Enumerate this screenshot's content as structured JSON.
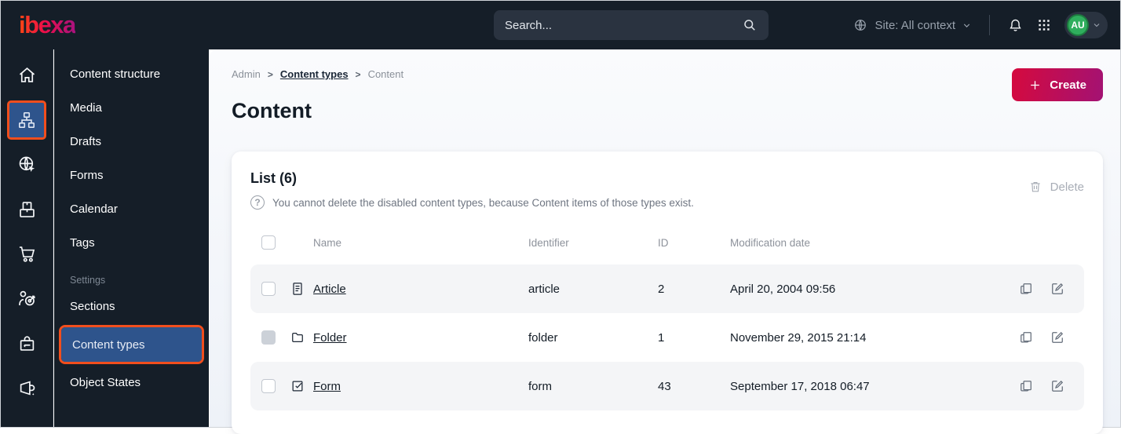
{
  "topbar": {
    "logo": "ibexa",
    "search_placeholder": "Search...",
    "site_context": "Site: All context",
    "avatar_initials": "AU"
  },
  "icon_rail": {
    "icons": [
      "home",
      "content-structure",
      "site",
      "product-catalog",
      "commerce",
      "personalization",
      "admin",
      "marketing"
    ],
    "selected": "content-structure"
  },
  "sidebar": {
    "items": [
      {
        "label": "Content structure"
      },
      {
        "label": "Media"
      },
      {
        "label": "Drafts"
      },
      {
        "label": "Forms"
      },
      {
        "label": "Calendar"
      },
      {
        "label": "Tags"
      }
    ],
    "settings_label": "Settings",
    "settings_items": [
      {
        "label": "Sections"
      },
      {
        "label": "Content types"
      },
      {
        "label": "Object States"
      }
    ],
    "selected_item": "Content types"
  },
  "main": {
    "breadcrumb": {
      "0": "Admin",
      "1": "Content types",
      "2": "Content"
    },
    "create_label": "Create",
    "page_title": "Content",
    "list": {
      "title": "List (6)",
      "info": "You cannot delete the disabled content types, because Content items of those types exist.",
      "delete_label": "Delete",
      "table": {
        "headers": {
          "0": "Name",
          "1": "Identifier",
          "2": "ID",
          "3": "Modification date"
        },
        "rows": [
          {
            "icon": "article-icon",
            "name": "Article",
            "identifier": "article",
            "id": "2",
            "modified": "April 20, 2004 09:56",
            "checkbox_disabled": false
          },
          {
            "icon": "folder-icon",
            "name": "Folder",
            "identifier": "folder",
            "id": "1",
            "modified": "November 29, 2015 21:14",
            "checkbox_disabled": true
          },
          {
            "icon": "form-icon",
            "name": "Form",
            "identifier": "form",
            "id": "43",
            "modified": "September 17, 2018 06:47",
            "checkbox_disabled": false
          }
        ]
      }
    }
  },
  "colors": {
    "topbar_bg": "#151e28",
    "selected_blue": "#2e548c",
    "annotation_orange": "#f14e1d",
    "create_gradient_start": "#d50a3e",
    "create_gradient_end": "#a31273",
    "avatar_green": "#2fae5d",
    "row_alt_bg": "#f4f5f7"
  }
}
